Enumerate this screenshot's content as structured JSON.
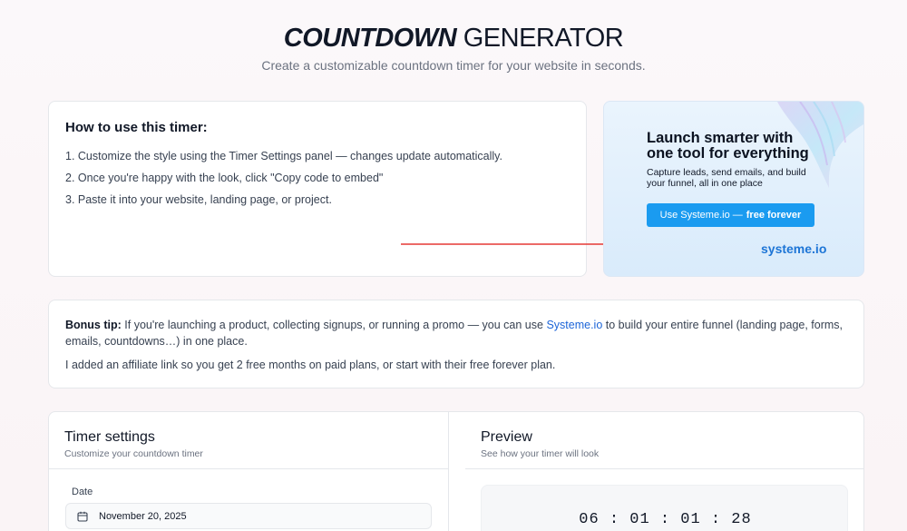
{
  "header": {
    "title_bold": "COUNTDOWN",
    "title_light": "GENERATOR",
    "subtitle": "Create a customizable countdown timer for your website in seconds."
  },
  "how_to": {
    "title": "How to use this timer:",
    "steps": [
      "1. Customize the style using the Timer Settings panel — changes update automatically.",
      "2. Once you're happy with the look, click \"Copy code to embed\"",
      "3. Paste it into your website, landing page, or project."
    ]
  },
  "promo": {
    "headline_1": "Launch smarter with",
    "headline_2": "one tool for everything",
    "sub_1": "Capture leads, send emails, and build",
    "sub_2": "your funnel, all in one place",
    "button_prefix": "Use Systeme.io —",
    "button_bold": "free forever",
    "logo": "systeme.io"
  },
  "bonus": {
    "label": "Bonus tip:",
    "text_before": " If you're launching a product, collecting signups, or running a promo — you can use ",
    "link": "Systeme.io",
    "text_after": " to build your entire funnel (landing page, forms, emails, countdowns…) in one place.",
    "note": "I added an affiliate link so you get 2 free months on paid plans, or start with their free forever plan."
  },
  "settings": {
    "title": "Timer settings",
    "subtitle": "Customize your countdown timer",
    "date_label": "Date",
    "date_value": "November 20, 2025"
  },
  "preview": {
    "title": "Preview",
    "subtitle": "See how your timer will look",
    "timer": "06 : 01 : 01 : 28"
  },
  "colors": {
    "accent": "#1a9bf0",
    "link": "#1d65d8",
    "arrow": "#e53935"
  }
}
